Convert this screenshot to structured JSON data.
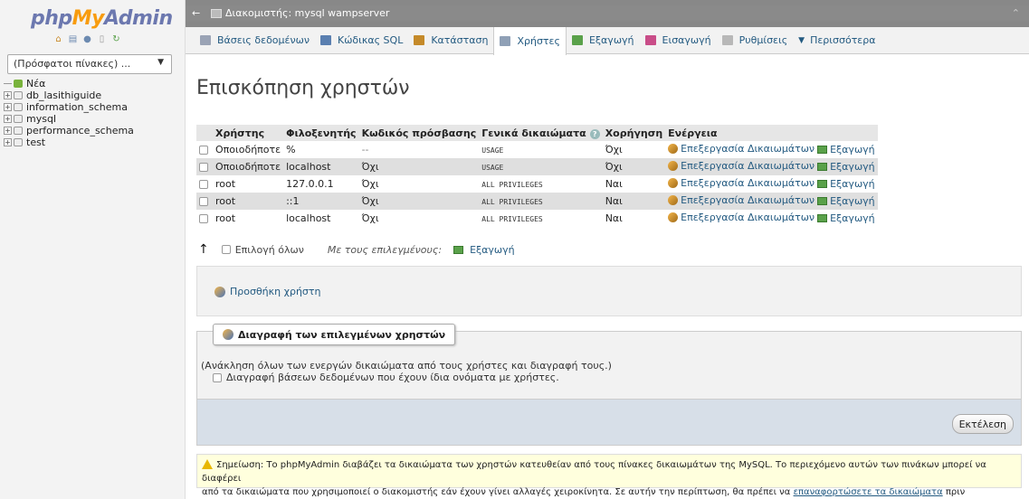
{
  "sidebar": {
    "logo": {
      "php": "php",
      "my": "My",
      "admin": "Admin"
    },
    "logo_icons": [
      "home-icon",
      "database-icon",
      "help-icon",
      "docs-icon",
      "reload-icon"
    ],
    "recent_label": "(Πρόσφατοι πίνακες) ...",
    "tree": [
      {
        "label": "Νέα",
        "type": "new"
      },
      {
        "label": "db_lasithiguide",
        "type": "db"
      },
      {
        "label": "information_schema",
        "type": "db"
      },
      {
        "label": "mysql",
        "type": "db"
      },
      {
        "label": "performance_schema",
        "type": "db"
      },
      {
        "label": "test",
        "type": "db"
      }
    ]
  },
  "titlebar": {
    "back": "←",
    "server": "Διακομιστής: mysql wampserver",
    "collapse": "⌃"
  },
  "tabs": [
    {
      "label": "Βάσεις δεδομένων",
      "icon": "databases-icon",
      "color": "#9aa3b5",
      "active": false
    },
    {
      "label": "Κώδικας SQL",
      "icon": "sql-icon",
      "color": "#5a7fb0",
      "active": false
    },
    {
      "label": "Κατάσταση",
      "icon": "status-icon",
      "color": "#c58a2a",
      "active": false
    },
    {
      "label": "Χρήστες",
      "icon": "users-icon",
      "color": "#8fa0b6",
      "active": true
    },
    {
      "label": "Εξαγωγή",
      "icon": "export-icon",
      "color": "#5aa14a",
      "active": false
    },
    {
      "label": "Εισαγωγή",
      "icon": "import-icon",
      "color": "#c94d88",
      "active": false
    },
    {
      "label": "Ρυθμίσεις",
      "icon": "settings-icon",
      "color": "#b8b8b8",
      "active": false
    },
    {
      "label": "Περισσότερα",
      "icon": "more-icon",
      "color": "",
      "active": false
    }
  ],
  "main": {
    "title": "Επισκόπηση χρηστών",
    "table": {
      "headers": [
        "Χρήστης",
        "Φιλοξενητής",
        "Κωδικός πρόσβασης",
        "Γενικά δικαιώματα",
        "Χορήγηση",
        "Ενέργεια"
      ],
      "rows": [
        {
          "user": "Οποιοδήποτε",
          "host": "%",
          "password": "--",
          "privileges": "USAGE",
          "grant": "Όχι",
          "user_red": true,
          "pwd_red": false
        },
        {
          "user": "Οποιοδήποτε",
          "host": "localhost",
          "password": "Όχι",
          "privileges": "USAGE",
          "grant": "Όχι",
          "user_red": true,
          "pwd_red": true
        },
        {
          "user": "root",
          "host": "127.0.0.1",
          "password": "Όχι",
          "privileges": "ALL PRIVILEGES",
          "grant": "Ναι",
          "user_red": false,
          "pwd_red": true
        },
        {
          "user": "root",
          "host": "::1",
          "password": "Όχι",
          "privileges": "ALL PRIVILEGES",
          "grant": "Ναι",
          "user_red": false,
          "pwd_red": true
        },
        {
          "user": "root",
          "host": "localhost",
          "password": "Όχι",
          "privileges": "ALL PRIVILEGES",
          "grant": "Ναι",
          "user_red": false,
          "pwd_red": true
        }
      ],
      "edit_label": "Επεξεργασία Δικαιωμάτων",
      "export_label": "Εξαγωγή"
    },
    "select_all": "Επιλογή όλων",
    "with_selected": "Με τους επιλεγμένους:",
    "export_selected": "Εξαγωγή",
    "add_user": "Προσθήκη χρήστη",
    "delete": {
      "legend": "Διαγραφή των επιλεγμένων χρηστών",
      "revoke_text": "(Ανάκληση όλων των ενεργών δικαιώματα από τους χρήστες και διαγραφή τους.)",
      "drop_db": "Διαγραφή βάσεων δεδομένων που έχουν ίδια ονόματα με χρήστες.",
      "go": "Εκτέλεση"
    },
    "notice": {
      "text1": "Σημείωση: Το phpMyAdmin διαβάζει τα δικαιώματα των χρηστών κατευθείαν από τους πίνακες δικαιωμάτων της MySQL. Το περιεχόμενο αυτών των πινάκων μπορεί να διαφέρει",
      "text2": "από τα δικαιώματα που χρησιμοποιεί ο διακομιστής εάν έχουν γίνει αλλαγές χειροκίνητα. Σε αυτήν την περίπτωση, θα πρέπει να",
      "link": "επαναφορτώσετε τα δικαιώματα",
      "text3": "πριν συνεχίσετε."
    }
  }
}
